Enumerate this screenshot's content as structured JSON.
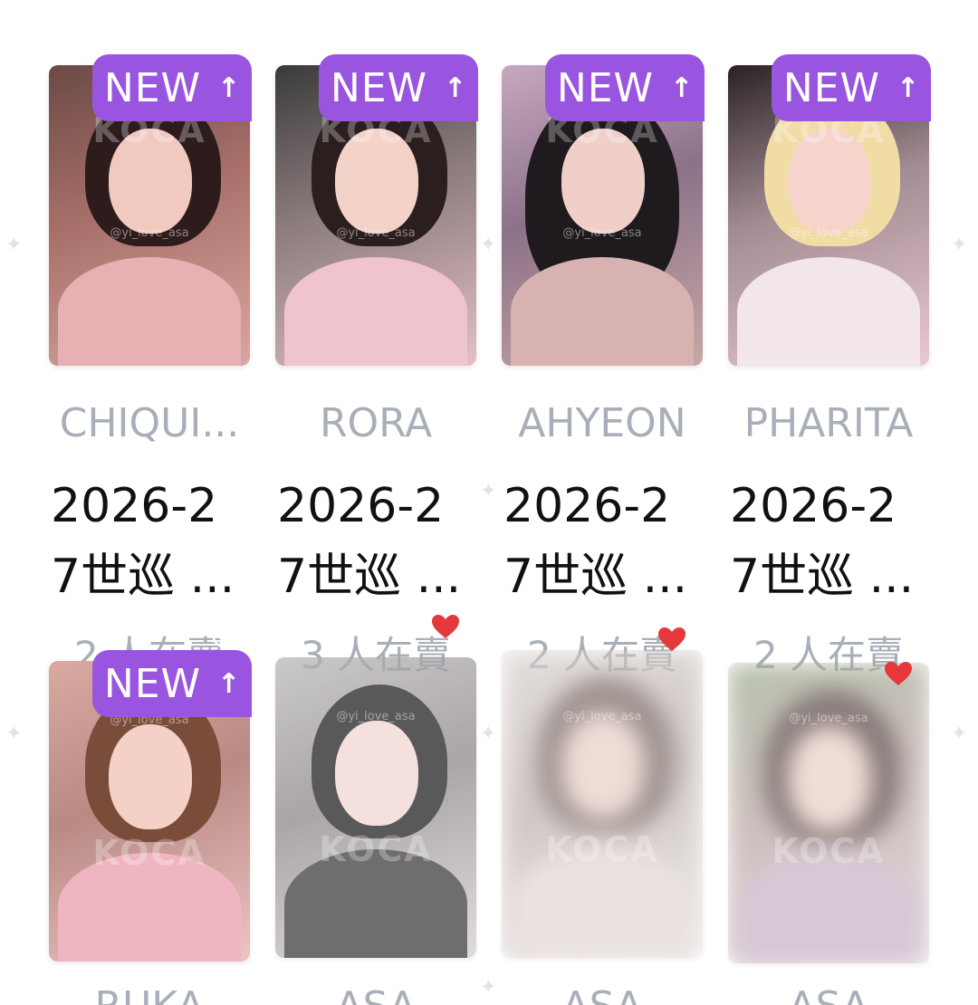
{
  "badge": {
    "label": "NEW",
    "arrow": "↑",
    "color": "#9a55e0"
  },
  "watermark": {
    "brand": "KOCA",
    "handle": "@yi_love_asa"
  },
  "row1": [
    {
      "name": "CHIQUI...",
      "title_line1": "2026-2",
      "title_line2": "7世巡 ...",
      "sellers": "2 人在賣",
      "is_new": true,
      "status_icon": "check-circle-icon"
    },
    {
      "name": "RORA",
      "title_line1": "2026-2",
      "title_line2": "7世巡 ...",
      "sellers": "3 人在賣",
      "is_new": true,
      "status_icon": "check-circle-icon"
    },
    {
      "name": "AHYEON",
      "title_line1": "2026-2",
      "title_line2": "7世巡 ...",
      "sellers": "2 人在賣",
      "is_new": true,
      "status_icon": "check-circle-icon"
    },
    {
      "name": "PHARITA",
      "title_line1": "2026-2",
      "title_line2": "7世巡 ...",
      "sellers": "2 人在賣",
      "is_new": true,
      "status_icon": "check-circle-icon"
    }
  ],
  "row2": [
    {
      "name": "RUKA",
      "is_new": true,
      "status_icon": "check-circle-icon"
    },
    {
      "name": "ASA",
      "is_new": false,
      "status_icon": "heart-icon"
    },
    {
      "name": "ASA",
      "is_new": false,
      "status_icon": "heart-icon"
    },
    {
      "name": "ASA",
      "is_new": false,
      "status_icon": "heart-icon"
    }
  ],
  "colors": {
    "heart": "#e5383b",
    "muted_text": "#a9afb8"
  }
}
